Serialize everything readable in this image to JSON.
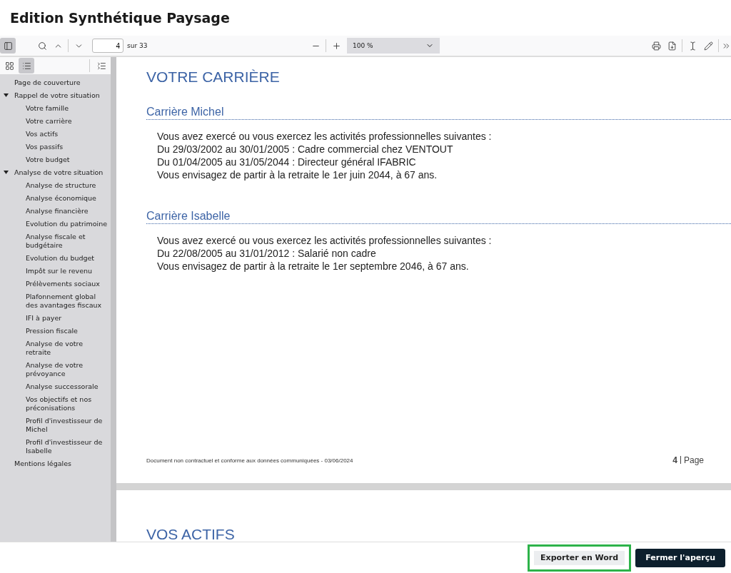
{
  "window": {
    "title": "Edition Synthétique Paysage"
  },
  "toolbar": {
    "sidebar_toggle": {
      "selected": true
    },
    "page_input": {
      "value": "4"
    },
    "page_total": "sur 33",
    "zoom": {
      "value": "100 %"
    }
  },
  "sidebar": {
    "views": [
      {
        "kind": "thumbnails",
        "selected": false
      },
      {
        "kind": "outline",
        "selected": true
      }
    ],
    "outline": [
      {
        "label": "Page de couverture"
      },
      {
        "label": "Rappel de votre situation",
        "expanded": true,
        "children": [
          {
            "label": "Votre famille"
          },
          {
            "label": "Votre carrière"
          },
          {
            "label": "Vos actifs"
          },
          {
            "label": "Vos passifs"
          },
          {
            "label": "Votre budget"
          }
        ]
      },
      {
        "label": "Analyse de votre situation",
        "expanded": true,
        "children": [
          {
            "label": "Analyse de structure"
          },
          {
            "label": "Analyse économique"
          },
          {
            "label": "Analyse financière"
          },
          {
            "label": "Evolution du patrimoine"
          },
          {
            "label": "Analyse fiscale et budgétaire"
          },
          {
            "label": "Evolution du budget"
          },
          {
            "label": "Impôt sur le revenu"
          },
          {
            "label": "Prélèvements sociaux"
          },
          {
            "label": "Plafonnement global des avantages fiscaux"
          },
          {
            "label": "IFI à payer"
          },
          {
            "label": "Pression fiscale"
          },
          {
            "label": "Analyse de votre retraite"
          },
          {
            "label": "Analyse de votre prévoyance"
          },
          {
            "label": "Analyse successorale"
          },
          {
            "label": "Vos objectifs et nos préconisations"
          },
          {
            "label": "Profil d'investisseur de Michel"
          },
          {
            "label": "Profil d'investisseur de Isabelle"
          }
        ]
      },
      {
        "label": "Mentions légales"
      }
    ]
  },
  "document": {
    "page": {
      "title": "VOTRE CARRIÈRE",
      "sections": [
        {
          "heading": "Carrière Michel",
          "lines": [
            "Vous avez exercé ou vous exercez les activités professionnelles suivantes :",
            "Du 29/03/2002 au 30/01/2005 : Cadre commercial chez VENTOUT",
            "Du 01/04/2005 au 31/05/2044 : Directeur général IFABRIC",
            "Vous envisagez de partir à la retraite le 1er juin 2044, à 67 ans."
          ]
        },
        {
          "heading": "Carrière Isabelle",
          "lines": [
            "Vous avez exercé ou vous exercez les activités professionnelles suivantes :",
            "Du 22/08/2005 au 31/01/2012 : Salarié non cadre",
            "Vous envisagez de partir à la retraite le 1er septembre 2046, à 67 ans."
          ]
        }
      ],
      "footer_note": "Document non contractuel et conforme aux données communiquées - 03/06/2024",
      "page_number": "4",
      "page_label": "Page"
    },
    "next_page": {
      "title": "VOS ACTIFS"
    }
  },
  "footer": {
    "buttons": [
      {
        "label": "Exporter en Word",
        "kind": "secondary",
        "highlighted": true
      },
      {
        "label": "Fermer l'aperçu",
        "kind": "primary",
        "highlighted": false
      }
    ]
  }
}
